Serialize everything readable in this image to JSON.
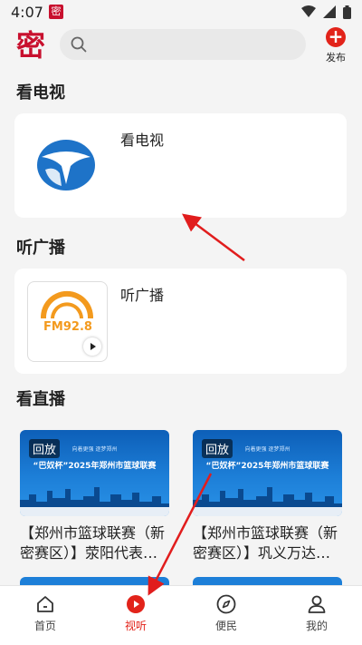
{
  "status_bar": {
    "time": "4:07",
    "app_badge": "密"
  },
  "header": {
    "logo_text": "密",
    "search_placeholder": "",
    "publish_label": "发布"
  },
  "sections": {
    "tv": {
      "title": "看电视",
      "card_label": "看电视"
    },
    "radio": {
      "title": "听广播",
      "card_label": "听广播",
      "thumb_text": "FM92.8"
    },
    "live": {
      "title": "看直播",
      "items": [
        {
          "badge": "回放",
          "slogan": "向着更强  逐梦郑州",
          "banner": "“巴奴杯”2025年郑州市篮球联赛",
          "title": "【郑州市篮球联赛（新密赛区）】荥阳代表…"
        },
        {
          "badge": "回放",
          "slogan": "向着更强  逐梦郑州",
          "banner": "“巴奴杯”2025年郑州市篮球联赛",
          "title": "【郑州市篮球联赛（新密赛区）】巩义万达…"
        }
      ]
    }
  },
  "bottom_nav": [
    {
      "label": "首页",
      "icon": "home-icon",
      "active": false
    },
    {
      "label": "视听",
      "icon": "play-circle-icon",
      "active": true
    },
    {
      "label": "便民",
      "icon": "compass-icon",
      "active": false
    },
    {
      "label": "我的",
      "icon": "user-icon",
      "active": false
    }
  ],
  "colors": {
    "accent": "#e2231a",
    "brand": "#c8102e",
    "thumb_blue": "#1d7fd8"
  }
}
